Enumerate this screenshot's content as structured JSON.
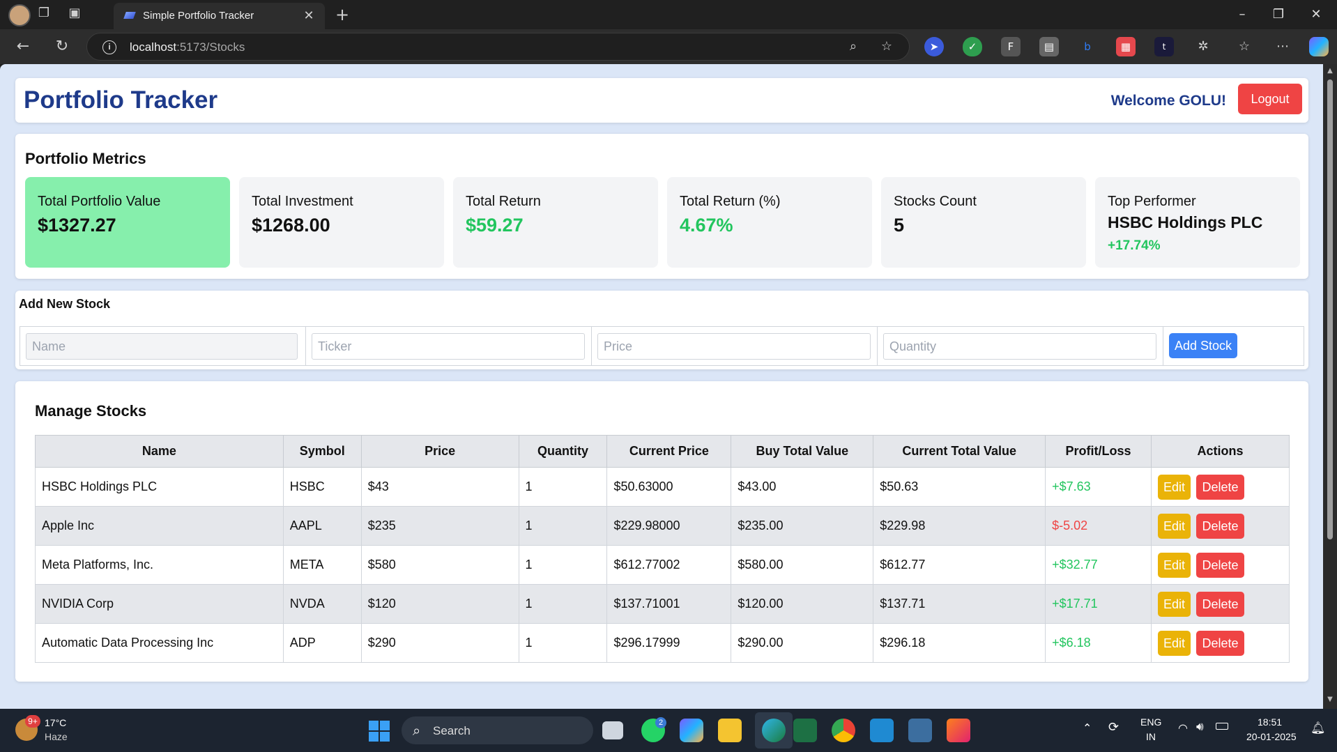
{
  "browser": {
    "tab_title": "Simple Portfolio Tracker",
    "url_host": "localhost",
    "url_path": ":5173/Stocks"
  },
  "header": {
    "title": "Portfolio Tracker",
    "welcome": "Welcome GOLU!",
    "logout_label": "Logout"
  },
  "metrics": {
    "section_title": "Portfolio Metrics",
    "total_value_label": "Total Portfolio Value",
    "total_value": "$1327.27",
    "total_investment_label": "Total Investment",
    "total_investment": "$1268.00",
    "total_return_label": "Total Return",
    "total_return": "$59.27",
    "total_return_pct_label": "Total Return (%)",
    "total_return_pct": "4.67%",
    "stocks_count_label": "Stocks Count",
    "stocks_count": "5",
    "top_performer_label": "Top Performer",
    "top_performer_name": "HSBC Holdings PLC",
    "top_performer_change": "+17.74%"
  },
  "add_stock": {
    "title": "Add New Stock",
    "name_placeholder": "Name",
    "ticker_placeholder": "Ticker",
    "price_placeholder": "Price",
    "quantity_placeholder": "Quantity",
    "button_label": "Add Stock"
  },
  "manage": {
    "title": "Manage Stocks",
    "columns": [
      "Name",
      "Symbol",
      "Price",
      "Quantity",
      "Current Price",
      "Buy Total Value",
      "Current Total Value",
      "Profit/Loss",
      "Actions"
    ],
    "edit_label": "Edit",
    "delete_label": "Delete",
    "rows": [
      {
        "name": "HSBC Holdings PLC",
        "symbol": "HSBC",
        "price": "$43",
        "quantity": "1",
        "current_price": "$50.63000",
        "buy_total": "$43.00",
        "current_total": "$50.63",
        "pl": "+$7.63",
        "pl_sign": "pos"
      },
      {
        "name": "Apple Inc",
        "symbol": "AAPL",
        "price": "$235",
        "quantity": "1",
        "current_price": "$229.98000",
        "buy_total": "$235.00",
        "current_total": "$229.98",
        "pl": "$-5.02",
        "pl_sign": "neg"
      },
      {
        "name": "Meta Platforms, Inc.",
        "symbol": "META",
        "price": "$580",
        "quantity": "1",
        "current_price": "$612.77002",
        "buy_total": "$580.00",
        "current_total": "$612.77",
        "pl": "+$32.77",
        "pl_sign": "pos"
      },
      {
        "name": "NVIDIA Corp",
        "symbol": "NVDA",
        "price": "$120",
        "quantity": "1",
        "current_price": "$137.71001",
        "buy_total": "$120.00",
        "current_total": "$137.71",
        "pl": "+$17.71",
        "pl_sign": "pos"
      },
      {
        "name": "Automatic Data Processing Inc",
        "symbol": "ADP",
        "price": "$290",
        "quantity": "1",
        "current_price": "$296.17999",
        "buy_total": "$290.00",
        "current_total": "$296.18",
        "pl": "+$6.18",
        "pl_sign": "pos"
      }
    ]
  },
  "taskbar": {
    "weather_badge": "9+",
    "temperature": "17°C",
    "weather": "Haze",
    "search_label": "Search",
    "whatsapp_badge": "2",
    "lang_primary": "ENG",
    "lang_region": "IN",
    "time": "18:51",
    "date": "20-01-2025"
  },
  "colors": {
    "brand": "#1e3a8a",
    "danger": "#ef4444",
    "warning": "#eab308",
    "primary": "#3b82f6",
    "success": "#22c55e",
    "highlight": "#86efac"
  },
  "icons": [
    "profile-avatar-icon",
    "workspaces-icon",
    "vertical-tabs-icon",
    "back-icon",
    "refresh-icon",
    "info-icon",
    "zoom-icon",
    "favorite-star-icon",
    "extensions-icon",
    "favorites-icon",
    "more-icon",
    "copilot-icon",
    "windows-start-icon",
    "search-icon",
    "wifi-icon",
    "volume-icon",
    "battery-icon",
    "notification-bell-icon"
  ]
}
